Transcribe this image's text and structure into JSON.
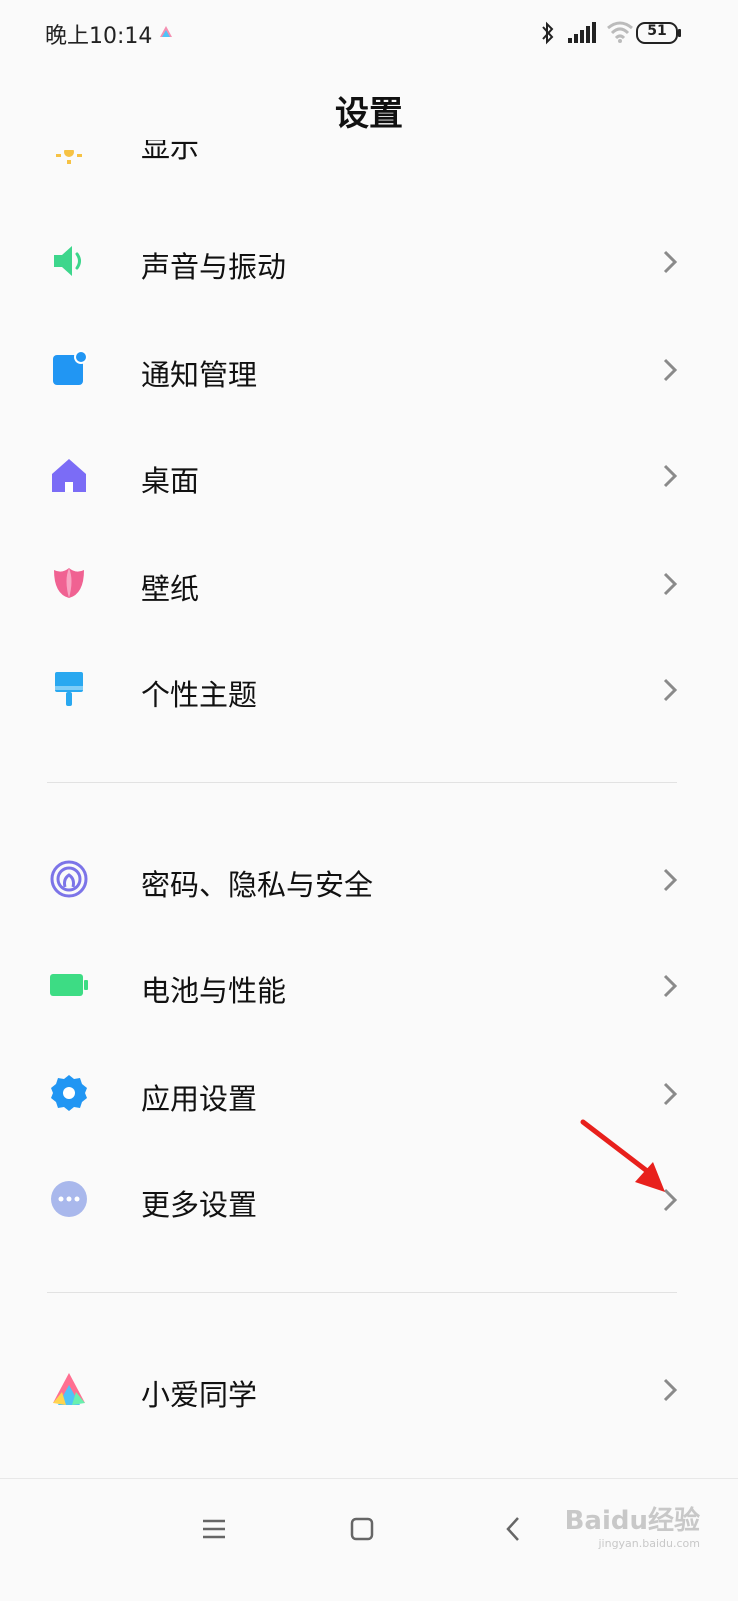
{
  "status_bar": {
    "time": "晚上10:14",
    "battery": "51"
  },
  "page": {
    "title": "设置"
  },
  "settings": {
    "partial_label": "显示",
    "items": [
      {
        "label": "声音与振动",
        "icon": "speaker-icon",
        "color": "#3dd68c"
      },
      {
        "label": "通知管理",
        "icon": "notification-icon",
        "color": "#2196f3"
      },
      {
        "label": "桌面",
        "icon": "home-icon",
        "color": "#7b6cf6"
      },
      {
        "label": "壁纸",
        "icon": "tulip-icon",
        "color": "#f06292"
      },
      {
        "label": "个性主题",
        "icon": "brush-icon",
        "color": "#29a8f0"
      },
      {
        "label": "密码、隐私与安全",
        "icon": "fingerprint-icon",
        "color": "#7c74e8"
      },
      {
        "label": "电池与性能",
        "icon": "battery-icon",
        "color": "#3ddc84"
      },
      {
        "label": "应用设置",
        "icon": "gear-icon",
        "color": "#2196f3"
      },
      {
        "label": "更多设置",
        "icon": "more-icon",
        "color": "#9fb2f0"
      },
      {
        "label": "小爱同学",
        "icon": "xiaoai-icon",
        "color": "#ff6f91"
      }
    ]
  },
  "watermark": {
    "brand": "Baidu经验",
    "url": "jingyan.baidu.com"
  },
  "colors": {
    "accent_arrow": "#e8201c",
    "chevron": "#8a8a8a"
  }
}
